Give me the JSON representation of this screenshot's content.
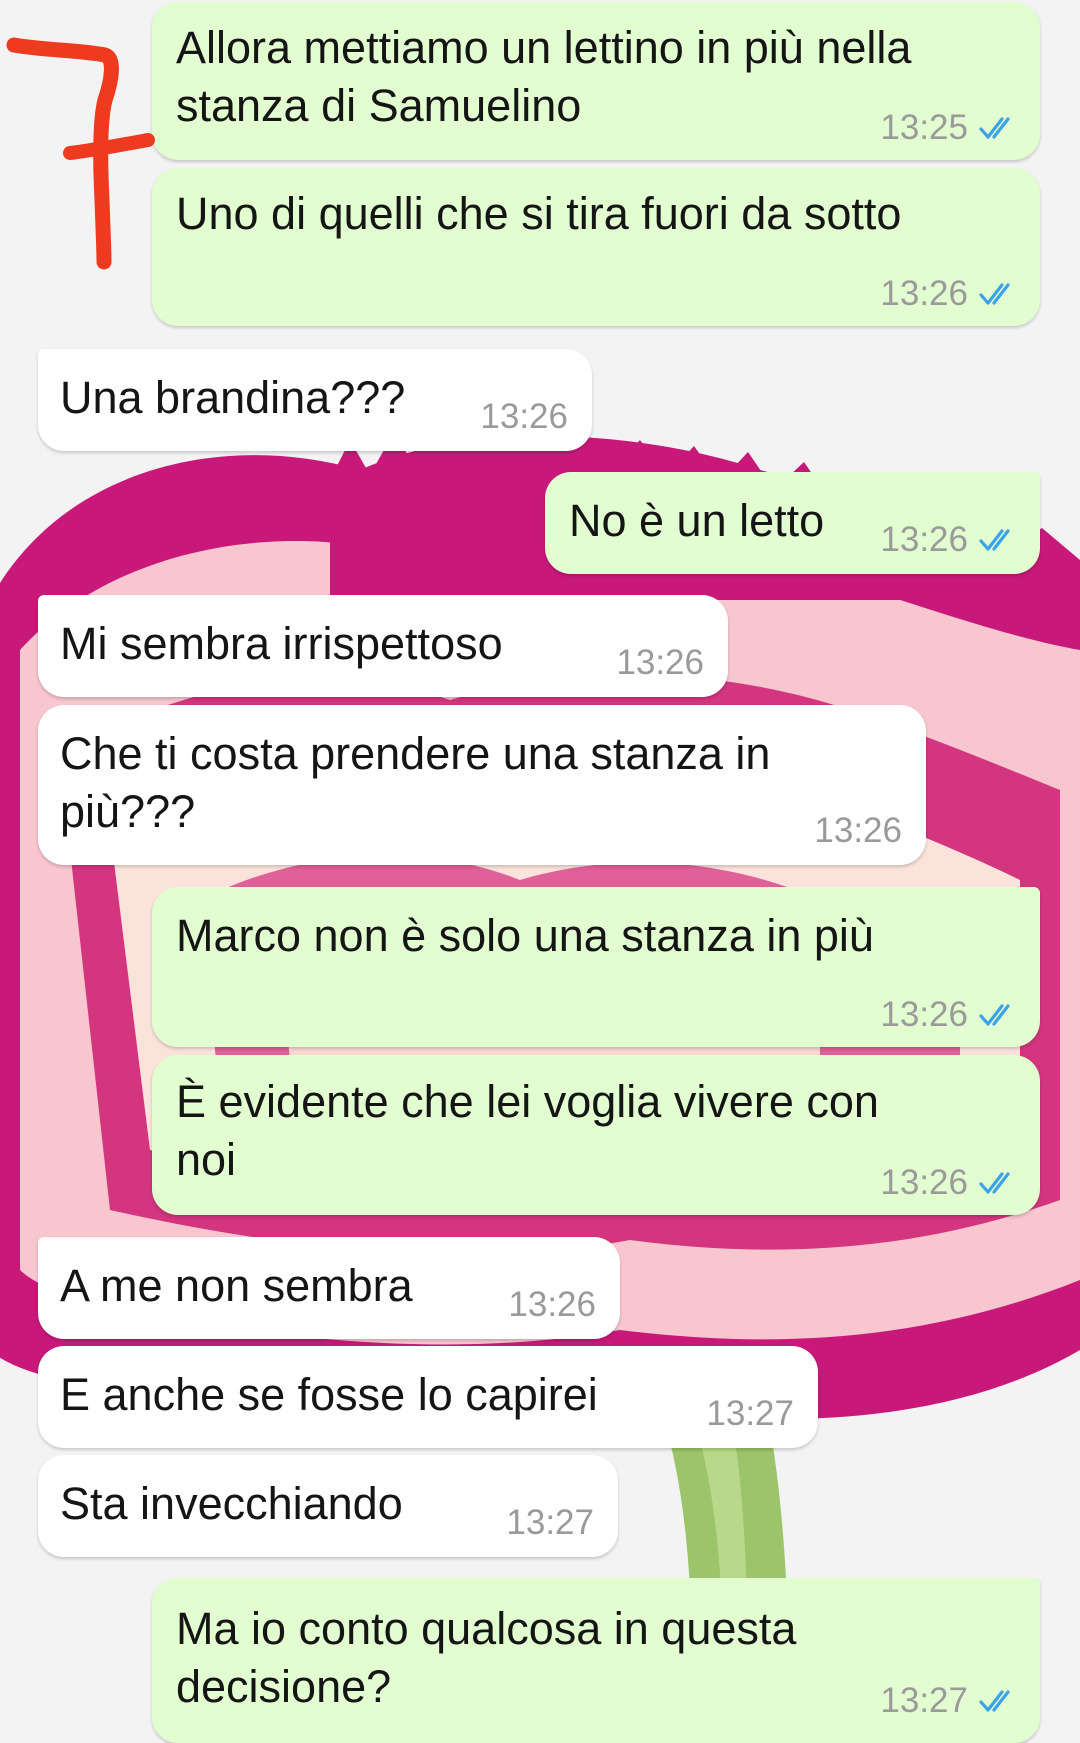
{
  "colors": {
    "outgoing_bubble": "#e2fdd0",
    "incoming_bubble": "#ffffff",
    "timestamp": "#9a9a9a",
    "read_ticks": "#3ba3e8",
    "annotation_red": "#ee3a1f",
    "wallpaper_flower_magenta": "#c8197a",
    "wallpaper_flower_pink": "#f7c6cf",
    "wallpaper_stem_green": "#9cc46a"
  },
  "annotation": {
    "mark": "7"
  },
  "messages": [
    {
      "id": "m1",
      "direction": "out",
      "text": "Allora mettiamo un lettino in più nella\nstanza di Samuelino",
      "time": "13:25",
      "read": true
    },
    {
      "id": "m2",
      "direction": "out",
      "text": "Uno di quelli che si tira fuori da sotto",
      "time": "13:26",
      "read": true
    },
    {
      "id": "m3",
      "direction": "in",
      "text": "Una brandina???",
      "time": "13:26"
    },
    {
      "id": "m4",
      "direction": "out",
      "text": "No è un letto",
      "time": "13:26",
      "read": true
    },
    {
      "id": "m5",
      "direction": "in",
      "text": "Mi sembra irrispettoso",
      "time": "13:26"
    },
    {
      "id": "m6",
      "direction": "in",
      "text": "Che ti costa prendere una stanza in\npiù???",
      "time": "13:26"
    },
    {
      "id": "m7",
      "direction": "out",
      "text": "Marco non è solo una stanza in più",
      "time": "13:26",
      "read": true
    },
    {
      "id": "m8",
      "direction": "out",
      "text": "È evidente che lei voglia vivere con\nnoi",
      "time": "13:26",
      "read": true
    },
    {
      "id": "m9",
      "direction": "in",
      "text": "A me non sembra",
      "time": "13:26"
    },
    {
      "id": "m10",
      "direction": "in",
      "text": "E anche se fosse lo capirei",
      "time": "13:27"
    },
    {
      "id": "m11",
      "direction": "in",
      "text": "Sta invecchiando",
      "time": "13:27"
    },
    {
      "id": "m12",
      "direction": "out",
      "text": "Ma io conto qualcosa in questa\ndecisione?",
      "time": "13:27",
      "read": true
    }
  ]
}
